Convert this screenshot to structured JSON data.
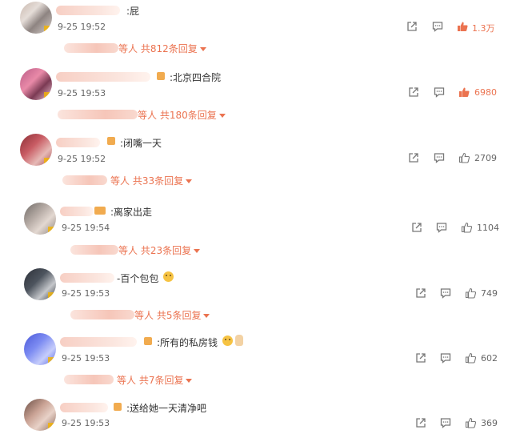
{
  "comments": [
    {
      "text": ":屁",
      "time": "9-25 19:52",
      "reply": "等人 共812条回复",
      "likes": "1.3万",
      "hot": true
    },
    {
      "text": ":北京四合院",
      "time": "9-25 19:53",
      "reply": "等人 共180条回复",
      "likes": "6980",
      "hot": true
    },
    {
      "text": ":闭嘴一天",
      "time": "9-25 19:52",
      "reply": "等人 共33条回复",
      "likes": "2709",
      "hot": false
    },
    {
      "text": ":离家出走",
      "time": "9-25 19:54",
      "reply": "等人 共23条回复",
      "likes": "1104",
      "hot": false
    },
    {
      "text": "-百个包包",
      "time": "9-25 19:53",
      "reply": "等人 共5条回复",
      "likes": "749",
      "hot": false
    },
    {
      "text": ":所有的私房钱",
      "time": "9-25 19:53",
      "reply": "等人 共7条回复",
      "likes": "602",
      "hot": false
    },
    {
      "text": ":送给她一天清净吧",
      "time": "9-25 19:53",
      "reply": "",
      "likes": "369",
      "hot": false
    }
  ],
  "icons": {
    "share": "share-icon",
    "comment": "comment-icon",
    "like": "thumbs-up-icon",
    "emoji": "doge-emoji-icon",
    "hand": "victory-hand-emoji-icon"
  },
  "colors": {
    "accent": "#eb7350",
    "text": "#333333",
    "muted": "#666666"
  }
}
